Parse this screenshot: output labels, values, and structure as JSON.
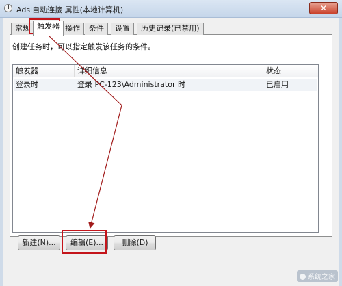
{
  "window": {
    "title": "Adsl自动连接 属性(本地计算机)",
    "close_label": "✕"
  },
  "tabs": [
    {
      "label": "常规",
      "active": false
    },
    {
      "label": "触发器",
      "active": true
    },
    {
      "label": "操作",
      "active": false
    },
    {
      "label": "条件",
      "active": false
    },
    {
      "label": "设置",
      "active": false
    },
    {
      "label": "历史记录(已禁用)",
      "active": false
    }
  ],
  "description": "创建任务时，可以指定触发该任务的条件。",
  "triggers_table": {
    "columns": [
      "触发器",
      "详细信息",
      "状态"
    ],
    "rows": [
      {
        "trigger": "登录时",
        "details": "登录 PC-123\\Administrator 时",
        "status": "已启用"
      }
    ]
  },
  "buttons": {
    "new": "新建(N)...",
    "edit": "编辑(E)...",
    "delete": "删除(D)"
  },
  "annotation_color": "#c4151b",
  "watermark": "系统之家"
}
